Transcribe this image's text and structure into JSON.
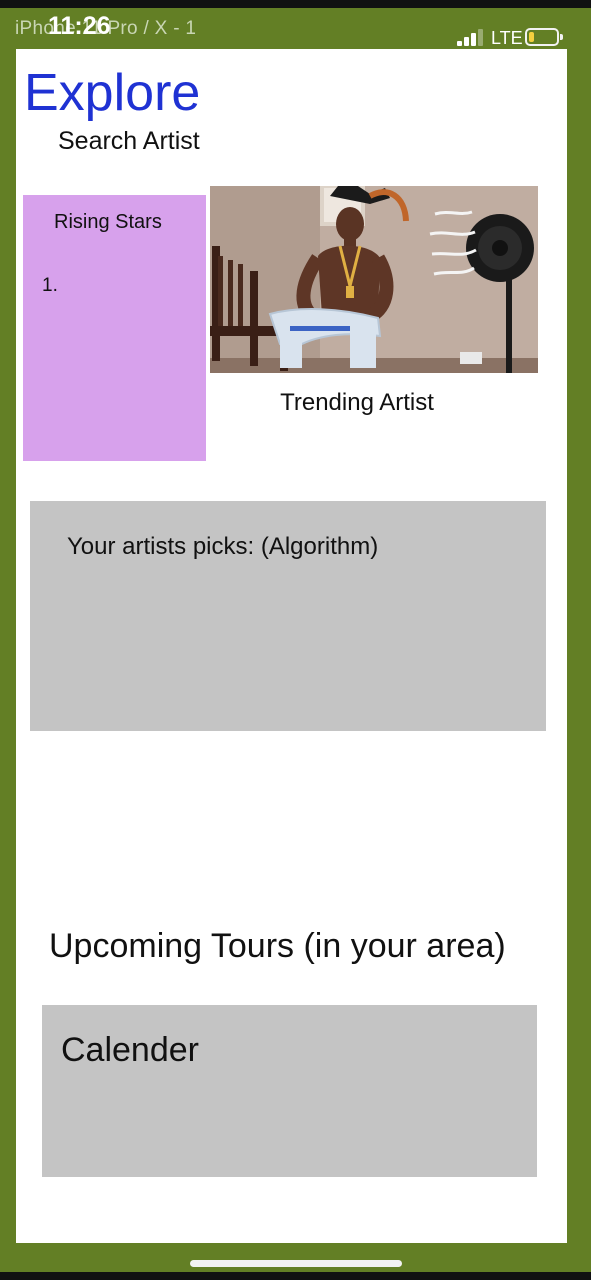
{
  "statusbar": {
    "device_label": "iPhone 11 Pro / X - 1",
    "time": "11:26",
    "network": "LTE",
    "battery_level": 0.2,
    "signal_bars": 3
  },
  "header": {
    "title": "Explore",
    "search_label": "Search Artist"
  },
  "rising_stars": {
    "title": "Rising Stars",
    "items": [
      "1."
    ]
  },
  "trending": {
    "label": "Trending Artist"
  },
  "picks": {
    "label": "Your artists picks: (Algorithm)"
  },
  "tours": {
    "heading": "Upcoming Tours (in your area)",
    "calendar_label": "Calender"
  },
  "colors": {
    "frame": "#637f25",
    "title": "#1f32d3",
    "rising_bg": "#d7a1ec",
    "panel_bg": "#c4c4c4"
  }
}
